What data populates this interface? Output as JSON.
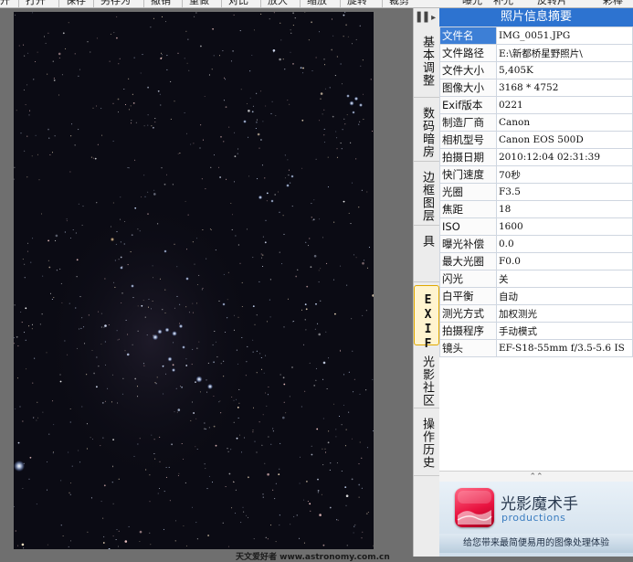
{
  "toolbar": {
    "left_items": [
      "开",
      "打开",
      "保存",
      "另存为",
      "撤销",
      "重做",
      "对比",
      "放大",
      "缩放",
      "旋转",
      "裁剪"
    ],
    "right_items": [
      "曝光",
      "补光",
      "反转片",
      "彩棒"
    ]
  },
  "side_tabs": {
    "toggle_label": "▌▌▸",
    "items": [
      {
        "label": "基本调整"
      },
      {
        "label": "数码暗房"
      },
      {
        "label": "边框图层"
      },
      {
        "label": "便捷工具"
      },
      {
        "label": "EXIF"
      },
      {
        "label": "光影社区"
      },
      {
        "label": "操作历史"
      }
    ],
    "active": "EXIF"
  },
  "panel": {
    "title": "照片信息摘要",
    "rows": [
      {
        "key": "文件名",
        "value": "IMG_0051.JPG"
      },
      {
        "key": "文件路径",
        "value": "E:\\新都桥星野照片\\"
      },
      {
        "key": "文件大小",
        "value": "5,405K"
      },
      {
        "key": "图像大小",
        "value": "3168 * 4752"
      },
      {
        "key": "Exif版本",
        "value": "0221"
      },
      {
        "key": "制造厂商",
        "value": "Canon"
      },
      {
        "key": "相机型号",
        "value": "Canon EOS 500D"
      },
      {
        "key": "拍摄日期",
        "value": "2010:12:04 02:31:39"
      },
      {
        "key": "快门速度",
        "value": "70秒"
      },
      {
        "key": "光圈",
        "value": "F3.5"
      },
      {
        "key": "焦距",
        "value": "18"
      },
      {
        "key": "ISO",
        "value": "1600"
      },
      {
        "key": "曝光补偿",
        "value": "0.0"
      },
      {
        "key": "最大光圈",
        "value": "F0.0"
      },
      {
        "key": "闪光",
        "value": "关"
      },
      {
        "key": "白平衡",
        "value": "自动"
      },
      {
        "key": "测光方式",
        "value": "加权测光"
      },
      {
        "key": "拍摄程序",
        "value": "手动模式"
      },
      {
        "key": "镜头",
        "value": "EF-S18-55mm f/3.5-5.6 IS"
      }
    ],
    "collapse_icon": "⌃⌃"
  },
  "ad": {
    "title": "光影魔术手",
    "subtitle": "productions",
    "tagline": "给您带来最简便易用的图像处理体验"
  },
  "watermark": "天文爱好者 www.astronomy.com.cn",
  "colors": {
    "accent": "#2d73d0",
    "active_tab": "#fff4cf",
    "sky": "#0b0b14"
  }
}
